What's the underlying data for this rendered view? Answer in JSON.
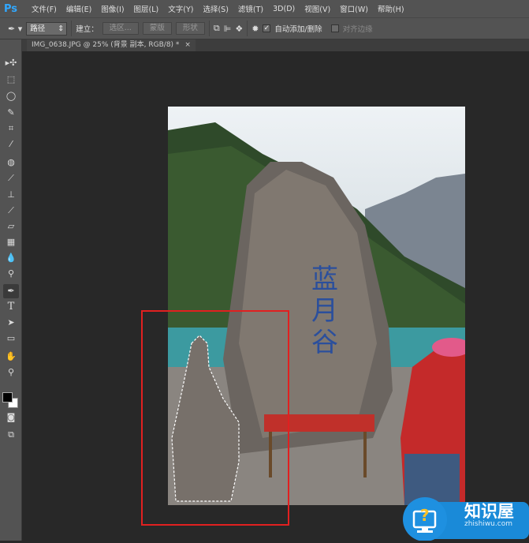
{
  "app": {
    "logo": "Ps"
  },
  "menu": [
    "文件(F)",
    "编辑(E)",
    "图像(I)",
    "图层(L)",
    "文字(Y)",
    "选择(S)",
    "滤镜(T)",
    "3D(D)",
    "视图(V)",
    "窗口(W)",
    "帮助(H)"
  ],
  "options": {
    "tool_icon": "pen-icon",
    "mode": "路径",
    "build_label": "建立：",
    "selection_btn": "选区...",
    "mask_btn": "蒙版",
    "shape_btn": "形状",
    "auto_add_delete": "自动添加/删除",
    "auto_add_checked": true,
    "align_edges": "对齐边缘",
    "align_checked": false
  },
  "document": {
    "tab_title": "IMG_0638.JPG @ 25% (背景 副本, RGB/8) *",
    "close": "×"
  },
  "tools": [
    "move-icon",
    "marquee-icon",
    "lasso-icon",
    "quick-select-icon",
    "crop-icon",
    "eyedropper-icon",
    "healing-icon",
    "brush-icon",
    "stamp-icon",
    "history-brush-icon",
    "eraser-icon",
    "gradient-icon",
    "blur-icon",
    "dodge-icon",
    "pen-icon",
    "type-icon",
    "path-select-icon",
    "rectangle-icon",
    "hand-icon",
    "zoom-icon"
  ],
  "colors": {
    "foreground": "#000000",
    "background": "#ffffff",
    "highlight": "#e12020",
    "accent": "#31a8ff"
  },
  "watermark": {
    "name": "知识屋",
    "url": "zhishiwu.com"
  }
}
